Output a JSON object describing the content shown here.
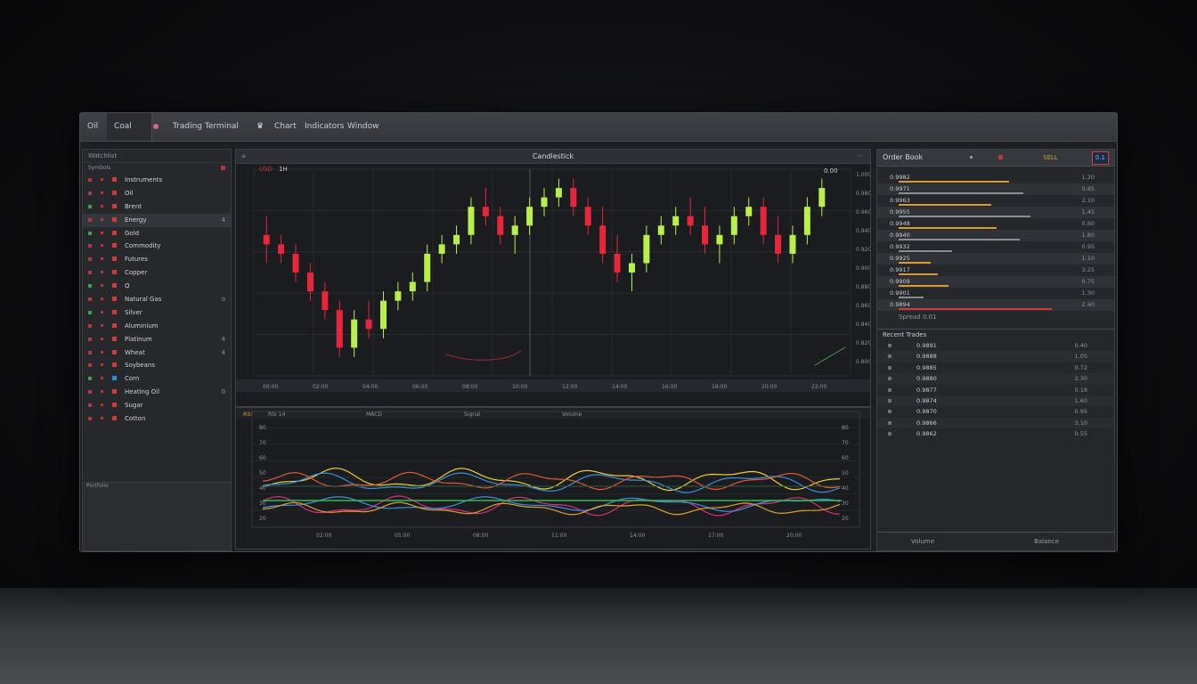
{
  "titlebar": {
    "tabs": [
      "Oil",
      "Coal"
    ],
    "app_title": "Trading Terminal",
    "menu_items": [
      "Chart",
      "Indicators",
      "Window"
    ]
  },
  "watchlist": {
    "title": "Watchlist",
    "subtitle": "Symbols",
    "items": [
      {
        "name": "Instruments",
        "value": "",
        "color": "#d23a3a"
      },
      {
        "name": "Oil",
        "value": "",
        "color": "#d23a3a"
      },
      {
        "name": "Brent",
        "value": "",
        "color": "#d23a3a"
      },
      {
        "name": "Energy",
        "value": "4",
        "color": "#d23a3a"
      },
      {
        "name": "Gold",
        "value": "",
        "color": "#d23a3a"
      },
      {
        "name": "Commodity",
        "value": "",
        "color": "#d23a3a"
      },
      {
        "name": "Futures",
        "value": "",
        "color": "#d23a3a"
      },
      {
        "name": "Copper",
        "value": "",
        "color": "#d23a3a"
      },
      {
        "name": "Q",
        "value": "",
        "color": "#d23a3a"
      },
      {
        "name": "Natural Gas",
        "value": "o",
        "color": "#d23a3a"
      },
      {
        "name": "Silver",
        "value": "",
        "color": "#d23a3a"
      },
      {
        "name": "Aluminium",
        "value": "",
        "color": "#d23a3a"
      },
      {
        "name": "Platinum",
        "value": "4",
        "color": "#d23a3a"
      },
      {
        "name": "Wheat",
        "value": "4",
        "color": "#d23a3a"
      },
      {
        "name": "Soybeans",
        "value": "",
        "color": "#d23a3a"
      },
      {
        "name": "Corn",
        "value": "",
        "color": "#2f8fd6"
      },
      {
        "name": "Heating Oil",
        "value": "0",
        "color": "#d23a3a"
      },
      {
        "name": "Sugar",
        "value": "",
        "color": "#d23a3a"
      },
      {
        "name": "Cotton",
        "value": "",
        "color": "#d23a3a"
      }
    ],
    "footer": "Portfolio"
  },
  "main_chart": {
    "title": "Candlestick",
    "symbol_label": "USD",
    "interval_label": "1H",
    "top_right_label": "0.00",
    "axis_labels": [
      "1.000",
      "0.980",
      "0.960",
      "0.940",
      "0.920",
      "0.900",
      "0.880",
      "0.860",
      "0.840",
      "0.820",
      "0.800"
    ],
    "footer_labels": [
      "00:00",
      "02:00",
      "04:00",
      "06:00",
      "08:00",
      "10:00",
      "12:00",
      "14:00",
      "16:00",
      "18:00",
      "20:00",
      "22:00"
    ]
  },
  "chart_data": {
    "type": "candlestick",
    "candles": [
      [
        0.93,
        0.95,
        0.9,
        0.92
      ],
      [
        0.92,
        0.93,
        0.9,
        0.91
      ],
      [
        0.91,
        0.92,
        0.88,
        0.89
      ],
      [
        0.89,
        0.9,
        0.86,
        0.87
      ],
      [
        0.87,
        0.88,
        0.84,
        0.85
      ],
      [
        0.85,
        0.86,
        0.8,
        0.81
      ],
      [
        0.81,
        0.85,
        0.8,
        0.84
      ],
      [
        0.84,
        0.86,
        0.82,
        0.83
      ],
      [
        0.83,
        0.87,
        0.82,
        0.86
      ],
      [
        0.86,
        0.88,
        0.85,
        0.87
      ],
      [
        0.87,
        0.89,
        0.86,
        0.88
      ],
      [
        0.88,
        0.92,
        0.87,
        0.91
      ],
      [
        0.91,
        0.93,
        0.9,
        0.92
      ],
      [
        0.92,
        0.94,
        0.91,
        0.93
      ],
      [
        0.93,
        0.97,
        0.92,
        0.96
      ],
      [
        0.96,
        0.98,
        0.94,
        0.95
      ],
      [
        0.95,
        0.96,
        0.92,
        0.93
      ],
      [
        0.93,
        0.95,
        0.91,
        0.94
      ],
      [
        0.94,
        0.97,
        0.93,
        0.96
      ],
      [
        0.96,
        0.98,
        0.95,
        0.97
      ],
      [
        0.97,
        0.99,
        0.96,
        0.98
      ],
      [
        0.98,
        0.99,
        0.95,
        0.96
      ],
      [
        0.96,
        0.97,
        0.93,
        0.94
      ],
      [
        0.94,
        0.96,
        0.9,
        0.91
      ],
      [
        0.91,
        0.93,
        0.88,
        0.89
      ],
      [
        0.89,
        0.91,
        0.87,
        0.9
      ],
      [
        0.9,
        0.94,
        0.89,
        0.93
      ],
      [
        0.93,
        0.95,
        0.92,
        0.94
      ],
      [
        0.94,
        0.96,
        0.93,
        0.95
      ],
      [
        0.95,
        0.97,
        0.93,
        0.94
      ],
      [
        0.94,
        0.96,
        0.91,
        0.92
      ],
      [
        0.92,
        0.94,
        0.9,
        0.93
      ],
      [
        0.93,
        0.96,
        0.92,
        0.95
      ],
      [
        0.95,
        0.97,
        0.94,
        0.96
      ],
      [
        0.96,
        0.97,
        0.92,
        0.93
      ],
      [
        0.93,
        0.95,
        0.9,
        0.91
      ],
      [
        0.91,
        0.94,
        0.9,
        0.93
      ],
      [
        0.93,
        0.97,
        0.92,
        0.96
      ],
      [
        0.96,
        0.99,
        0.95,
        0.98
      ]
    ]
  },
  "indicator_chart": {
    "title": "RSI",
    "header_labels": [
      "RSI 14",
      "MACD",
      "Signal",
      "Volume"
    ],
    "axis_labels": [
      "80",
      "70",
      "60",
      "50",
      "40",
      "30",
      "20"
    ],
    "time_labels": [
      "02:00",
      "05:00",
      "08:00",
      "11:00",
      "14:00",
      "17:00",
      "20:00"
    ]
  },
  "order_book": {
    "title": "Order Book",
    "badge": "SELL",
    "badge_value": "0.1",
    "rows": [
      {
        "price": "0.9982",
        "size": "1.20",
        "bar": 0.62,
        "color": "#d89a32"
      },
      {
        "price": "0.9971",
        "size": "0.85",
        "bar": 0.7,
        "color": "#8a8d93"
      },
      {
        "price": "0.9963",
        "size": "2.10",
        "bar": 0.52,
        "color": "#d89a32"
      },
      {
        "price": "0.9955",
        "size": "1.45",
        "bar": 0.74,
        "color": "#8a8d93"
      },
      {
        "price": "0.9948",
        "size": "0.60",
        "bar": 0.55,
        "color": "#d89a32"
      },
      {
        "price": "0.9940",
        "size": "1.80",
        "bar": 0.68,
        "color": "#8a8d93"
      },
      {
        "price": "0.9932",
        "size": "0.95",
        "bar": 0.3,
        "color": "#8a8d93"
      },
      {
        "price": "0.9925",
        "size": "1.10",
        "bar": 0.18,
        "color": "#d89a32"
      },
      {
        "price": "0.9917",
        "size": "3.25",
        "bar": 0.22,
        "color": "#d89a32"
      },
      {
        "price": "0.9909",
        "size": "0.75",
        "bar": 0.28,
        "color": "#d89a32"
      },
      {
        "price": "0.9901",
        "size": "1.30",
        "bar": 0.14,
        "color": "#8a8d93"
      },
      {
        "price": "0.9894",
        "size": "2.40",
        "bar": 0.86,
        "color": "#d23a3a"
      }
    ],
    "footer": "Spread 0.01"
  },
  "trades": {
    "title": "Recent Trades",
    "rows": [
      {
        "price": "0.9891",
        "size": "0.40"
      },
      {
        "price": "0.9888",
        "size": "1.05"
      },
      {
        "price": "0.9885",
        "size": "0.72"
      },
      {
        "price": "0.9880",
        "size": "2.30"
      },
      {
        "price": "0.9877",
        "size": "0.18"
      },
      {
        "price": "0.9874",
        "size": "1.60"
      },
      {
        "price": "0.9870",
        "size": "0.95"
      },
      {
        "price": "0.9866",
        "size": "3.10"
      },
      {
        "price": "0.9862",
        "size": "0.55"
      }
    ],
    "footer_left": "Volume",
    "footer_right": "Balance"
  }
}
